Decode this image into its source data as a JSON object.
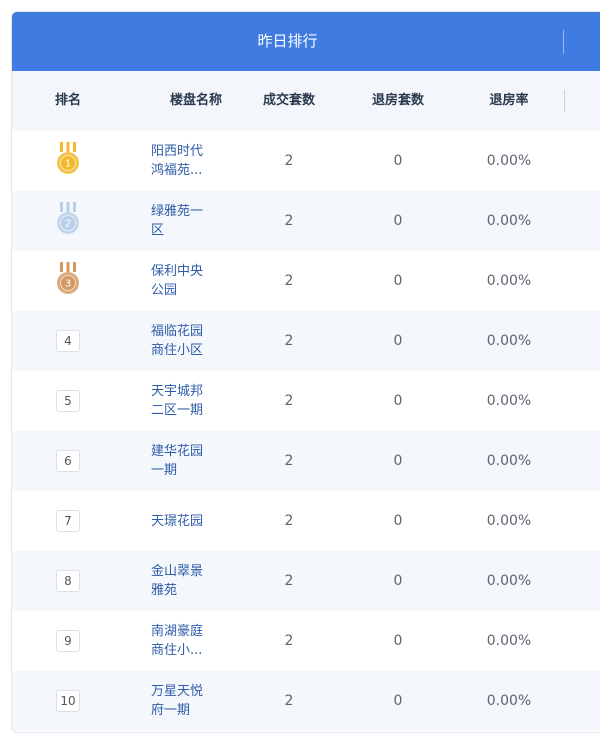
{
  "title": "昨日排行",
  "columns": [
    "排名",
    "楼盘名称",
    "成交套数",
    "退房套数",
    "退房率"
  ],
  "medal_colors": {
    "gold": "#f2b92a",
    "silver": "#b9cfe8",
    "bronze": "#d59a63"
  },
  "rows": [
    {
      "rank": "1",
      "medal": "gold",
      "name": "阳西时代鸿福苑...",
      "deals": "2",
      "returns": "0",
      "rate": "0.00%"
    },
    {
      "rank": "2",
      "medal": "silver",
      "name": "绿雅苑一区",
      "deals": "2",
      "returns": "0",
      "rate": "0.00%"
    },
    {
      "rank": "3",
      "medal": "bronze",
      "name": "保利中央公园",
      "deals": "2",
      "returns": "0",
      "rate": "0.00%"
    },
    {
      "rank": "4",
      "medal": "",
      "name": "福临花园商住小区",
      "deals": "2",
      "returns": "0",
      "rate": "0.00%"
    },
    {
      "rank": "5",
      "medal": "",
      "name": "天宇城邦二区一期",
      "deals": "2",
      "returns": "0",
      "rate": "0.00%"
    },
    {
      "rank": "6",
      "medal": "",
      "name": "建华花园一期",
      "deals": "2",
      "returns": "0",
      "rate": "0.00%"
    },
    {
      "rank": "7",
      "medal": "",
      "name": "天璟花园",
      "deals": "2",
      "returns": "0",
      "rate": "0.00%"
    },
    {
      "rank": "8",
      "medal": "",
      "name": "金山翠景雅苑",
      "deals": "2",
      "returns": "0",
      "rate": "0.00%"
    },
    {
      "rank": "9",
      "medal": "",
      "name": "南湖豪庭商住小...",
      "deals": "2",
      "returns": "0",
      "rate": "0.00%"
    },
    {
      "rank": "10",
      "medal": "",
      "name": "万星天悦府一期",
      "deals": "2",
      "returns": "0",
      "rate": "0.00%"
    }
  ]
}
